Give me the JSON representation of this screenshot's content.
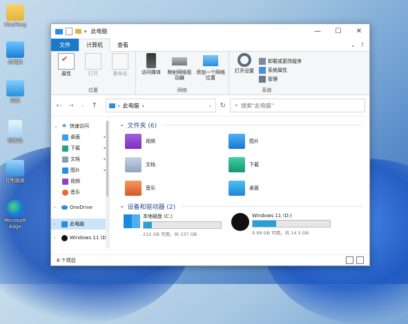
{
  "desktop": {
    "icons": [
      {
        "label": "XiaoFeng"
      },
      {
        "label": "此电脑"
      },
      {
        "label": "网络"
      },
      {
        "label": "回收站"
      },
      {
        "label": "控制面板"
      },
      {
        "label": "Microsoft Edge"
      }
    ]
  },
  "window": {
    "title": "此电脑",
    "controls": {
      "minimize": "—",
      "maximize": "☐",
      "close": "✕"
    }
  },
  "ribbon": {
    "tabs": [
      "文件",
      "计算机",
      "查看"
    ],
    "active_tab": "计算机",
    "groups": [
      {
        "name": "位置",
        "buttons": [
          "属性",
          "打开",
          "重命名"
        ]
      },
      {
        "name": "网络",
        "buttons": [
          "访问媒体",
          "映射网络驱动器",
          "添加一个网络位置"
        ]
      },
      {
        "name": "系统",
        "buttons": [
          "打开设置"
        ],
        "small": [
          "卸载或更改程序",
          "系统属性",
          "管理"
        ]
      }
    ]
  },
  "address": {
    "path_sep": "›",
    "path": "此电脑",
    "search_placeholder": "搜索\"此电脑\""
  },
  "navpane": {
    "items": [
      {
        "label": "快速访问",
        "type": "header"
      },
      {
        "label": "桌面",
        "pinned": true
      },
      {
        "label": "下载",
        "pinned": true
      },
      {
        "label": "文档",
        "pinned": true
      },
      {
        "label": "图片",
        "pinned": true
      },
      {
        "label": "视频"
      },
      {
        "label": "音乐"
      },
      {
        "label": "OneDrive",
        "type": "header"
      },
      {
        "label": "此电脑",
        "type": "header",
        "selected": true
      },
      {
        "label": "Windows 11 (D:",
        "type": "header"
      }
    ]
  },
  "content": {
    "folders_header": "文件夹 (6)",
    "folders": [
      "视频",
      "图片",
      "文档",
      "下载",
      "音乐",
      "桌面"
    ],
    "drives_header": "设备和驱动器 (2)",
    "drives": [
      {
        "name": "本地磁盘 (C:)",
        "size": "212 GB 可用，共 237 GB",
        "used_fraction": 0.105
      },
      {
        "name": "Windows 11 (D:)",
        "size": "9.99 GB 可用，共 14.3 GB",
        "used_fraction": 0.3
      }
    ]
  },
  "status": {
    "items": "8 个项目"
  },
  "colors": {
    "accent": "#1979ca",
    "drive_bar": "#26a0da"
  }
}
